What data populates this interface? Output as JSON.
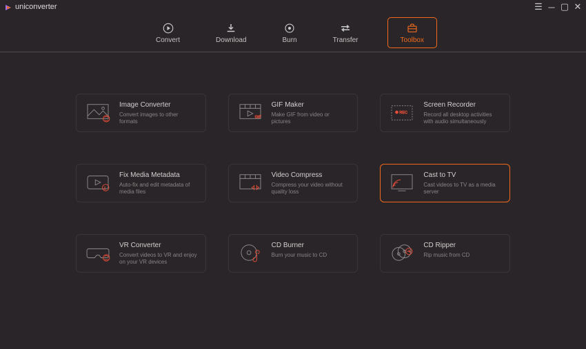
{
  "app": {
    "name": "uniconverter"
  },
  "header": {
    "items": [
      {
        "label": "Convert"
      },
      {
        "label": "Download"
      },
      {
        "label": "Burn"
      },
      {
        "label": "Transfer"
      },
      {
        "label": "Toolbox"
      }
    ]
  },
  "tools": [
    {
      "title": "Image Converter",
      "desc": "Convert images to other formats"
    },
    {
      "title": "GIF Maker",
      "desc": "Make GIF from video or pictures"
    },
    {
      "title": "Screen Recorder",
      "desc": "Record all desktop activities with audio simultaneously"
    },
    {
      "title": "Fix Media Metadata",
      "desc": "Auto-fix and edit metadata of media files"
    },
    {
      "title": "Video Compress",
      "desc": "Compress your video without quality loss"
    },
    {
      "title": "Cast to TV",
      "desc": "Cast videos to TV as a media server"
    },
    {
      "title": "VR Converter",
      "desc": "Convert videos to VR and enjoy on your VR devices"
    },
    {
      "title": "CD Burner",
      "desc": "Burn your music to CD"
    },
    {
      "title": "CD Ripper",
      "desc": "Rip music from CD"
    }
  ]
}
